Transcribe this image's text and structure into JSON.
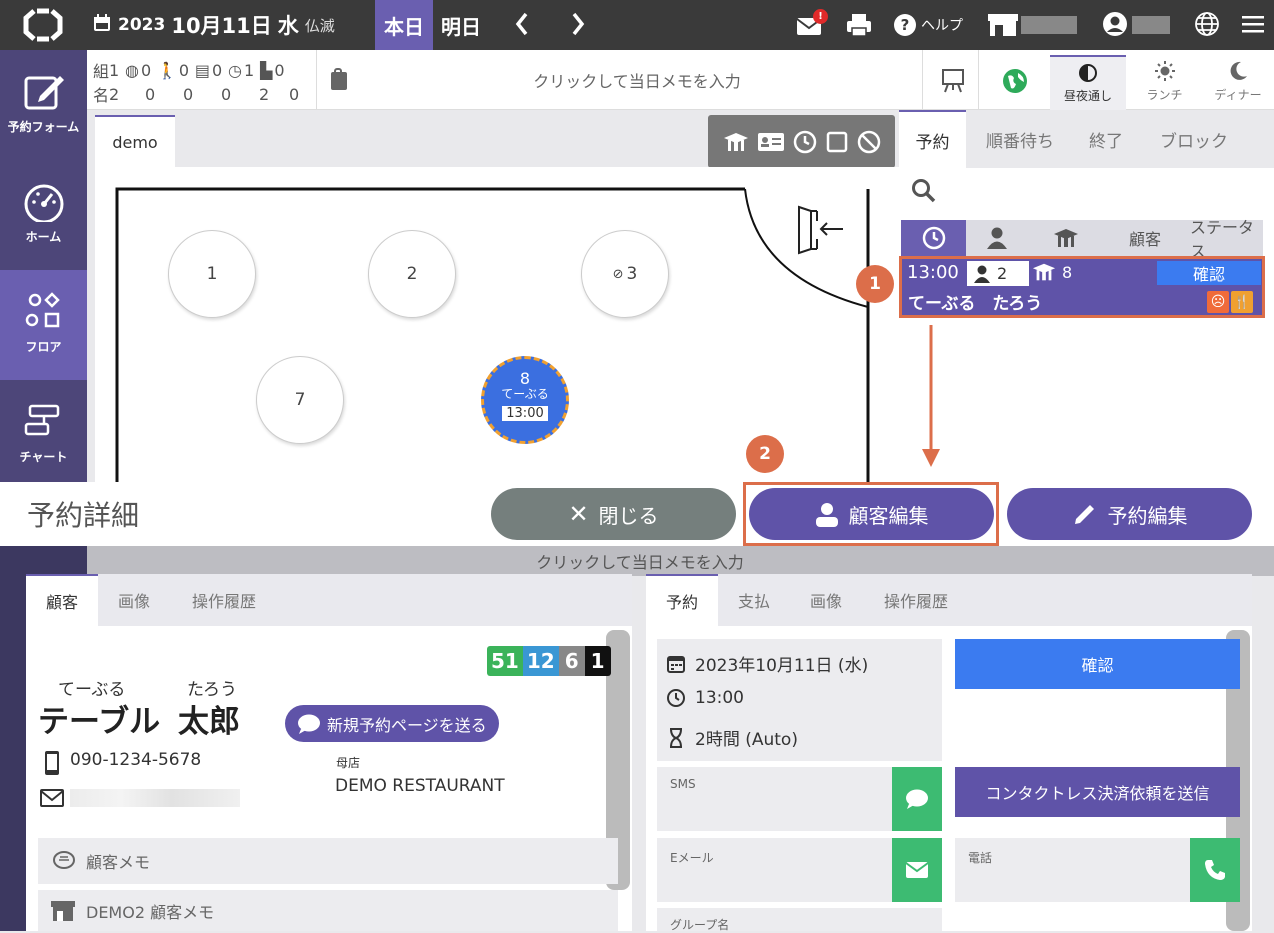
{
  "topbar": {
    "year": "2023",
    "month_day": "10月11日",
    "weekday": "水",
    "rokuyo": "仏滅",
    "today_label": "本日",
    "tomorrow_label": "明日",
    "help_label": "ヘルプ",
    "mail_badge": "!"
  },
  "sidebar": {
    "items": [
      {
        "label": "予約フォーム"
      },
      {
        "label": "ホーム"
      },
      {
        "label": "フロア"
      },
      {
        "label": "チャート"
      }
    ]
  },
  "counts": {
    "row1_prefix": "組",
    "row2_prefix": "名",
    "groups": [
      "1",
      "0",
      "0",
      "0",
      "1",
      "0"
    ],
    "people": [
      "2",
      "0",
      "0",
      "0",
      "2",
      "0"
    ]
  },
  "memo": {
    "placeholder": "クリックして当日メモを入力"
  },
  "modes": {
    "all_day": "昼夜通し",
    "lunch": "ランチ",
    "dinner": "ディナー"
  },
  "floor": {
    "tab": "demo",
    "tables": [
      {
        "label": "1"
      },
      {
        "label": "2"
      },
      {
        "label": "3"
      },
      {
        "label": "7"
      }
    ],
    "booked_table": {
      "number": "8",
      "name": "てーぶる",
      "time": "13:00"
    }
  },
  "right_panel": {
    "tabs": [
      "予約",
      "順番待ち",
      "終了",
      "ブロック"
    ],
    "list_headers": {
      "customer": "顧客",
      "status": "ステータス"
    },
    "reservation": {
      "time": "13:00",
      "people": "2",
      "table": "8",
      "status": "確認",
      "name": "てーぶる　たろう"
    }
  },
  "annotations": {
    "step1": "1",
    "step2": "2"
  },
  "detail": {
    "title": "予約詳細",
    "close": "閉じる",
    "edit_customer": "顧客編集",
    "edit_reservation": "予約編集"
  },
  "customer_card": {
    "tabs": [
      "顧客",
      "画像",
      "操作履歴"
    ],
    "stats": [
      "51",
      "12",
      "6",
      "1"
    ],
    "stat_colors": [
      "#3bb35a",
      "#3a97d4",
      "#888888",
      "#111111"
    ],
    "kana_last": "てーぶる",
    "kana_first": "たろう",
    "last_name": "テーブル",
    "first_name": "太郎",
    "send_page": "新規予約ページを送る",
    "phone": "090-1234-5678",
    "home_store_label": "母店",
    "home_store": "DEMO RESTAURANT",
    "memo_label": "顧客メモ",
    "store_memo_label": "DEMO2 顧客メモ"
  },
  "reservation_card": {
    "tabs": [
      "予約",
      "支払",
      "画像",
      "操作履歴"
    ],
    "date": "2023年10月11日 (水)",
    "time": "13:00",
    "duration": "2時間 (Auto)",
    "status_button": "確認",
    "sms_label": "SMS",
    "email_label": "Eメール",
    "contactless": "コンタクトレス決済依頼を送信",
    "phone_label": "電話",
    "group_label": "グループ名"
  }
}
